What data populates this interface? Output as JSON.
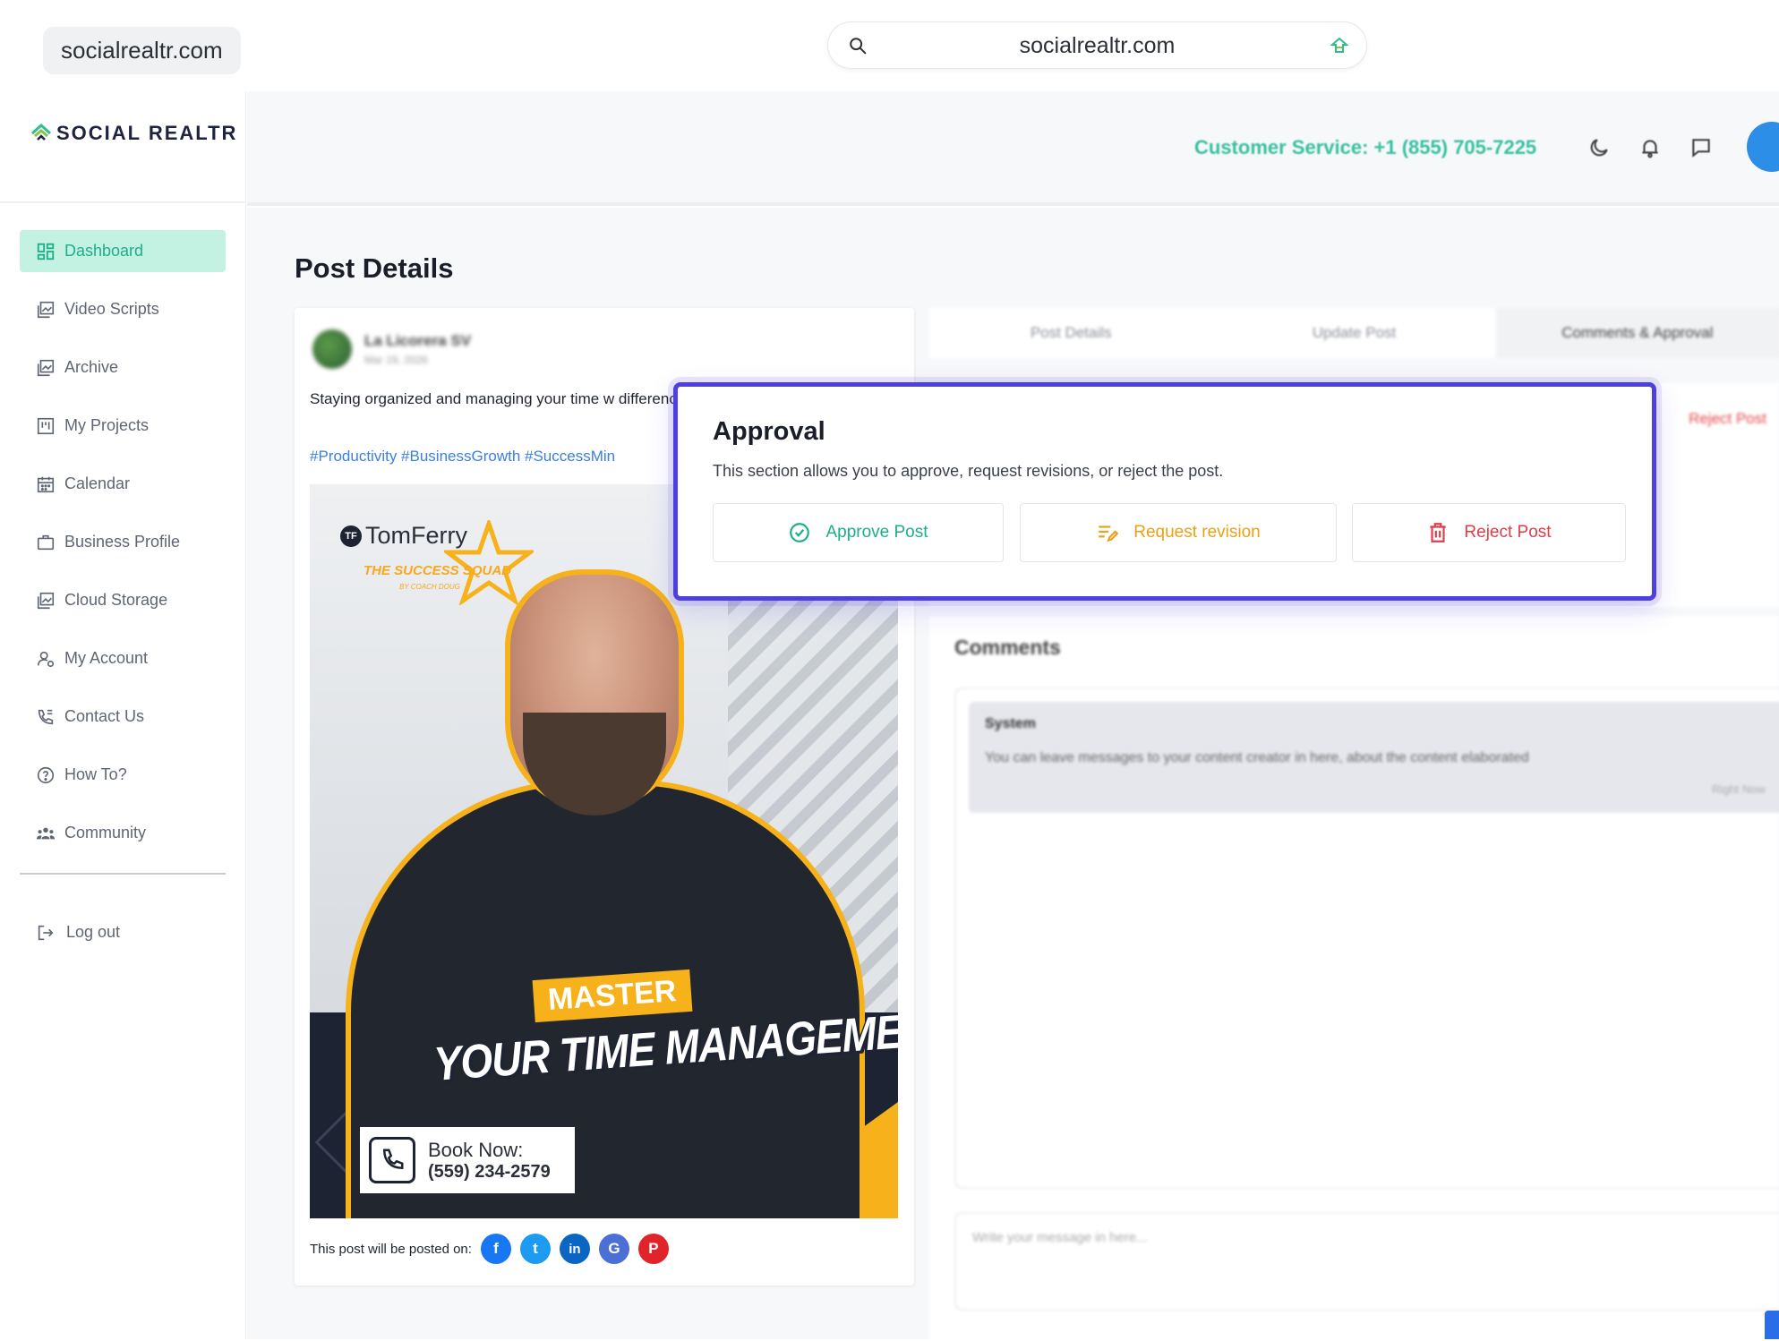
{
  "browser": {
    "domain_chip": "socialrealtr.com",
    "url": "socialrealtr.com"
  },
  "brand": {
    "name": "SOCIAL REALTR"
  },
  "sidebar": {
    "items": [
      {
        "label": "Dashboard",
        "icon": "dashboard-icon",
        "active": true
      },
      {
        "label": "Video Scripts",
        "icon": "gallery-icon"
      },
      {
        "label": "Archive",
        "icon": "gallery-icon"
      },
      {
        "label": "My Projects",
        "icon": "kanban-icon"
      },
      {
        "label": "Calendar",
        "icon": "calendar-icon"
      },
      {
        "label": "Business Profile",
        "icon": "briefcase-icon"
      },
      {
        "label": "Cloud Storage",
        "icon": "gallery-icon"
      },
      {
        "label": "My Account",
        "icon": "user-gear-icon"
      },
      {
        "label": "Contact Us",
        "icon": "phone-book-icon"
      },
      {
        "label": "How To?",
        "icon": "help-circle-icon"
      },
      {
        "label": "Community",
        "icon": "users-icon"
      }
    ],
    "logout": "Log out"
  },
  "header": {
    "customer_service": "Customer Service: +1 (855) 705-7225"
  },
  "page": {
    "title": "Post Details"
  },
  "post": {
    "author": "La Licorera SV",
    "date": "Mar 19, 2026",
    "text": "Staying organized and managing your time w difference in business and life.",
    "tags": "#Productivity #BusinessGrowth #SuccessMin",
    "image": {
      "brand": "TomFerry",
      "tf": "TF",
      "squad": "THE SUCCESS SQUAD",
      "squad_sub": "BY COACH DOUG",
      "master": "MASTER",
      "headline": "YOUR TIME MANAGEMENT",
      "book_label": "Book Now:",
      "book_phone": "(559) 234-2579"
    },
    "posted_on_label": "This post will be posted on:",
    "networks": [
      {
        "name": "facebook",
        "glyph": "f",
        "color": "#1877f2"
      },
      {
        "name": "twitter",
        "glyph": "t",
        "color": "#1d9bf0"
      },
      {
        "name": "linkedin",
        "glyph": "in",
        "color": "#0a66c2"
      },
      {
        "name": "google-business",
        "glyph": "G",
        "color": "#4c6fd6"
      },
      {
        "name": "pinterest",
        "glyph": "P",
        "color": "#e0242a"
      }
    ]
  },
  "tabs": [
    "Post Details",
    "Update Post",
    "Comments & Approval"
  ],
  "background_reject": "Reject Post",
  "comments": {
    "title": "Comments",
    "system_name": "System",
    "system_text": "You can leave messages to your content creator in here, about the content elaborated",
    "system_time": "Right Now",
    "input_placeholder": "Write your message in here..."
  },
  "approval": {
    "title": "Approval",
    "description": "This section allows you to approve, request revisions, or reject the post.",
    "approve_label": "Approve Post",
    "revision_label": "Request revision",
    "reject_label": "Reject Post"
  },
  "colors": {
    "accent_green": "#1fae8a",
    "active_bg": "#c4f2e2",
    "highlight_border": "#4f3fe0",
    "revision_orange": "#e9a117",
    "reject_red": "#e03c4a",
    "link_blue": "#3b7fe0"
  }
}
